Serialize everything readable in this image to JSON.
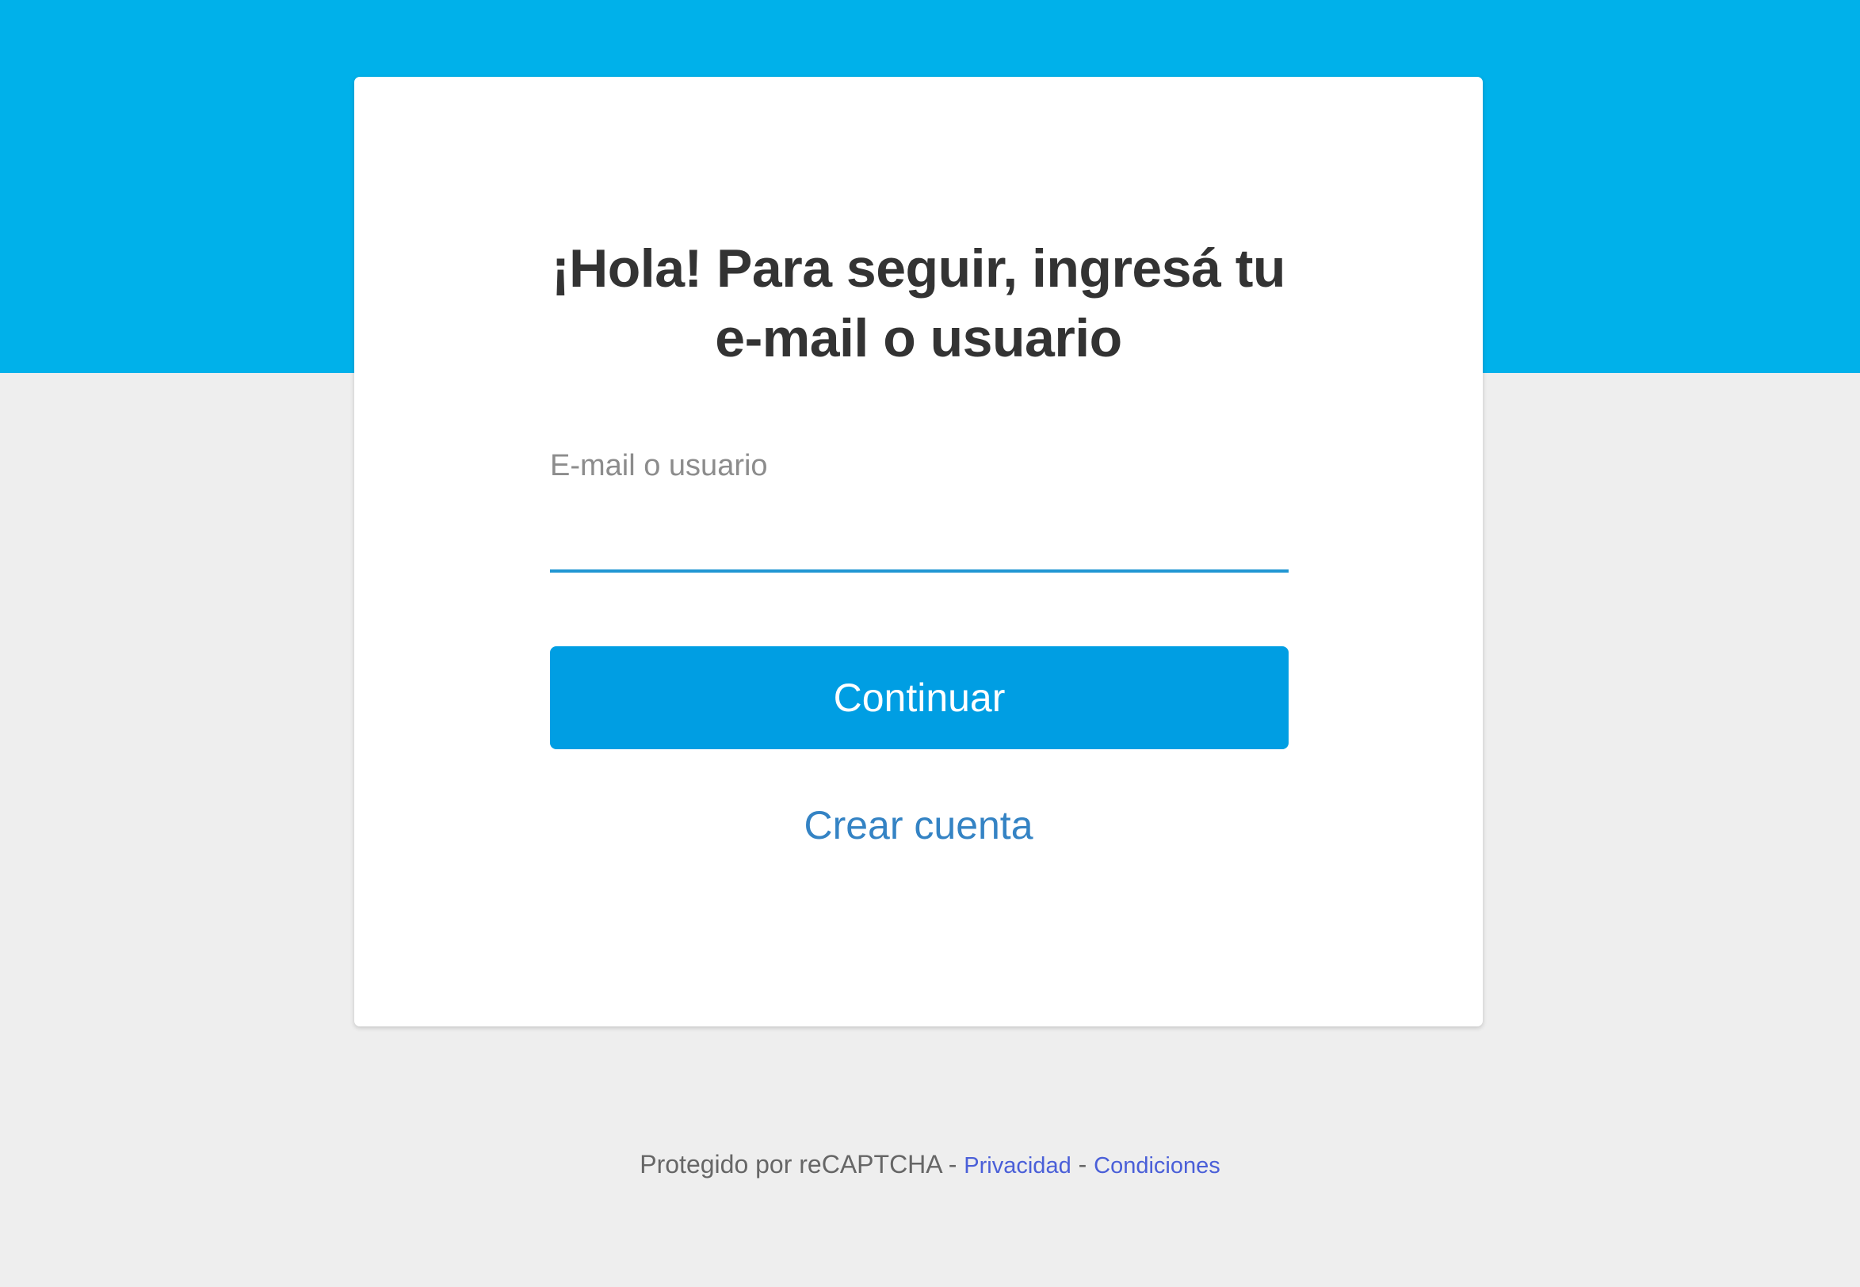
{
  "colors": {
    "header_background": "#00b1ea",
    "page_background": "#eeeeee",
    "primary_button": "#009ee3",
    "link": "#3483c4",
    "input_underline": "#2196d3"
  },
  "login": {
    "title_line1": "¡Hola! Para seguir, ingresá tu",
    "title_line2": "e-mail o usuario",
    "field_label": "E-mail o usuario",
    "field_value": "",
    "continue_label": "Continuar",
    "create_account_label": "Crear cuenta"
  },
  "footer": {
    "protected_text": "Protegido por reCAPTCHA",
    "separator": "-",
    "privacy_label": "Privacidad",
    "terms_label": "Condiciones"
  }
}
